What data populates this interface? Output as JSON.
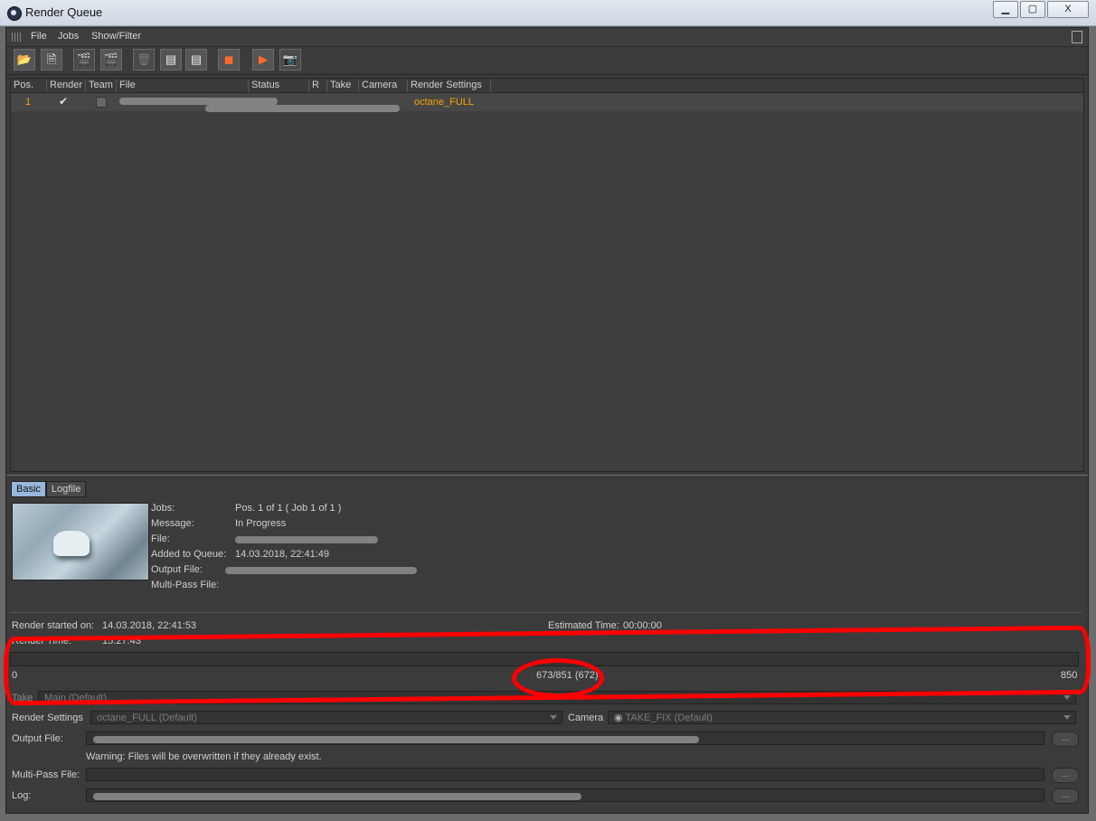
{
  "window": {
    "title": "Render Queue",
    "min": "▁",
    "max": "▢",
    "close": "X"
  },
  "menu": [
    "File",
    "Jobs",
    "Show/Filter"
  ],
  "columns": [
    "Pos.",
    "Render",
    "Team",
    "File",
    "Status",
    "R",
    "Take",
    "Camera",
    "Render Settings"
  ],
  "row": {
    "pos": "1",
    "render_mark": "✔",
    "render_settings": "octane_FULL"
  },
  "tabs": [
    "Basic",
    "Logfile"
  ],
  "details": {
    "jobs_label": "Jobs:",
    "jobs_value": "Pos. 1 of 1 ( Job 1 of 1 )",
    "message_label": "Message:",
    "message_value": "In Progress",
    "file_label": "File:",
    "added_label": "Added to Queue:",
    "added_value": "14.03.2018, 22:41:49",
    "output_label": "Output File:",
    "multipass_label": "Multi-Pass File:"
  },
  "render": {
    "started_label": "Render started on:",
    "started_value": "14.03.2018, 22:41:53",
    "estimated_label": "Estimated Time:",
    "estimated_value": "00:00:00",
    "time_label": "Render Time:",
    "time_value": "15:27:43",
    "progress_start": "0",
    "progress_text": "673/851 (672)",
    "progress_end": "850"
  },
  "settings": {
    "take_label": "Take",
    "take_value": "Main (Default)",
    "rs_label": "Render Settings",
    "rs_value": "octane_FULL (Default)",
    "camera_label": "Camera",
    "camera_value": "TAKE_FIX (Default)",
    "output_label": "Output File:",
    "warning": "Warning: Files will be overwritten if they already exist.",
    "multipass_label": "Multi-Pass File:",
    "log_label": "Log:",
    "browse": "..."
  },
  "colors": {
    "accent": "#f2a400",
    "tab_active": "#97b7dc",
    "annotation": "#ff0000"
  }
}
